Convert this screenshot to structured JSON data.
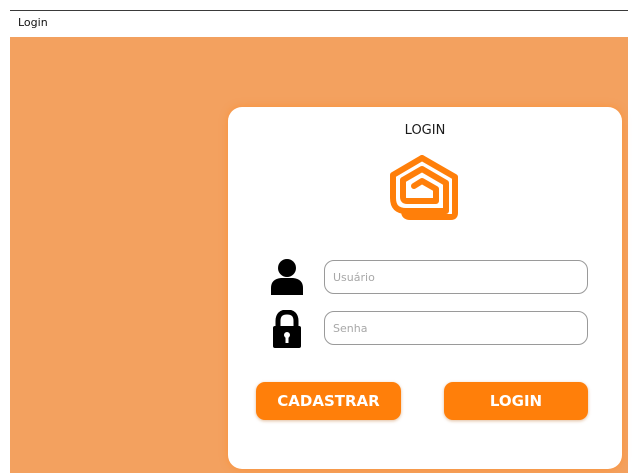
{
  "window": {
    "title": "Login"
  },
  "card": {
    "title": "LOGIN",
    "logo_icon": "house-outline-icon"
  },
  "form": {
    "username": {
      "icon": "user-icon",
      "placeholder": "Usuário",
      "value": ""
    },
    "password": {
      "icon": "lock-icon",
      "placeholder": "Senha",
      "value": ""
    }
  },
  "buttons": {
    "register_label": "CADASTRAR",
    "login_label": "LOGIN"
  },
  "colors": {
    "background": "#f3a15f",
    "accent": "#ff7f0a",
    "card": "#ffffff"
  }
}
